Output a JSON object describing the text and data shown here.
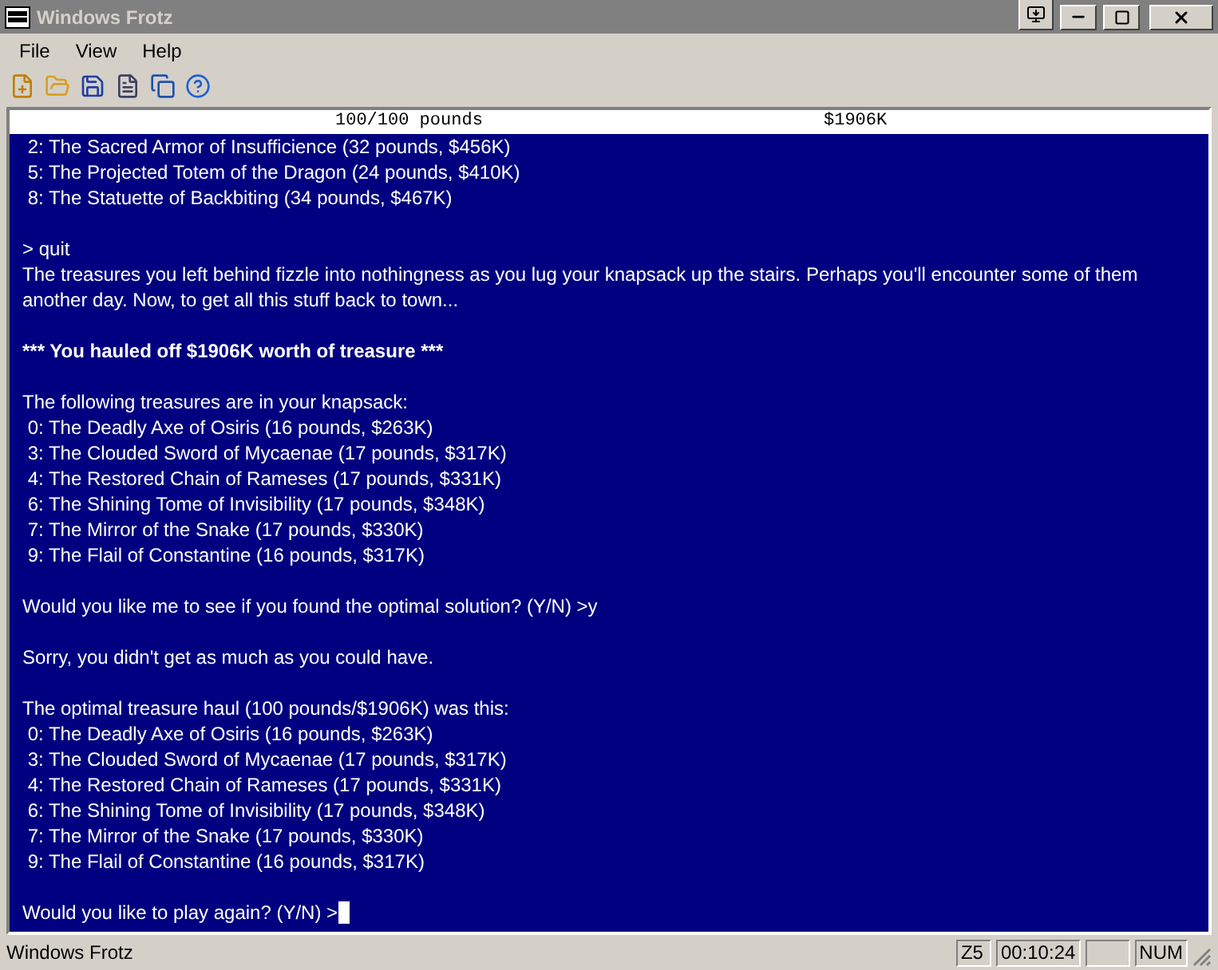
{
  "window": {
    "title": "Windows Frotz"
  },
  "menu": [
    {
      "label": "File"
    },
    {
      "label": "View"
    },
    {
      "label": "Help"
    }
  ],
  "status_line": {
    "left": "100/100 pounds",
    "right": "$1906K"
  },
  "transcript": [
    {
      "kind": "text",
      "text": " 2: The Sacred Armor of Insufficience (32 pounds, $456K)"
    },
    {
      "kind": "text",
      "text": " 5: The Projected Totem of the Dragon (24 pounds, $410K)"
    },
    {
      "kind": "text",
      "text": " 8: The Statuette of Backbiting (34 pounds, $467K)"
    },
    {
      "kind": "gap"
    },
    {
      "kind": "text",
      "text": "> quit"
    },
    {
      "kind": "text",
      "text": "The treasures you left behind fizzle into nothingness as you lug your knapsack up the stairs. Perhaps you'll encounter some of them another day. Now, to get all this stuff back to town..."
    },
    {
      "kind": "gap"
    },
    {
      "kind": "bold",
      "text": "*** You hauled off $1906K worth of treasure ***"
    },
    {
      "kind": "gap"
    },
    {
      "kind": "text",
      "text": "The following treasures are in your knapsack:"
    },
    {
      "kind": "text",
      "text": " 0: The Deadly Axe of Osiris (16 pounds, $263K)"
    },
    {
      "kind": "text",
      "text": " 3: The Clouded Sword of Mycaenae (17 pounds, $317K)"
    },
    {
      "kind": "text",
      "text": " 4: The Restored Chain of Rameses (17 pounds, $331K)"
    },
    {
      "kind": "text",
      "text": " 6: The Shining Tome of Invisibility (17 pounds, $348K)"
    },
    {
      "kind": "text",
      "text": " 7: The Mirror of the Snake (17 pounds, $330K)"
    },
    {
      "kind": "text",
      "text": " 9: The Flail of Constantine (16 pounds, $317K)"
    },
    {
      "kind": "gap"
    },
    {
      "kind": "text",
      "text": "Would you like me to see if you found the optimal solution? (Y/N) >y"
    },
    {
      "kind": "gap"
    },
    {
      "kind": "text",
      "text": "Sorry, you didn't get as much as you could have."
    },
    {
      "kind": "gap"
    },
    {
      "kind": "text",
      "text": "The optimal treasure haul (100 pounds/$1906K) was this:"
    },
    {
      "kind": "text",
      "text": " 0: The Deadly Axe of Osiris (16 pounds, $263K)"
    },
    {
      "kind": "text",
      "text": " 3: The Clouded Sword of Mycaenae (17 pounds, $317K)"
    },
    {
      "kind": "text",
      "text": " 4: The Restored Chain of Rameses (17 pounds, $331K)"
    },
    {
      "kind": "text",
      "text": " 6: The Shining Tome of Invisibility (17 pounds, $348K)"
    },
    {
      "kind": "text",
      "text": " 7: The Mirror of the Snake (17 pounds, $330K)"
    },
    {
      "kind": "text",
      "text": " 9: The Flail of Constantine (16 pounds, $317K)"
    },
    {
      "kind": "gap"
    },
    {
      "kind": "input",
      "text": "Would you like to play again? (Y/N) >"
    }
  ],
  "status_bar": {
    "text": "Windows Frotz",
    "panes": [
      {
        "kind": "text",
        "text": "Z5"
      },
      {
        "kind": "text",
        "text": "00:10:24"
      },
      {
        "kind": "blank"
      },
      {
        "kind": "text",
        "text": "NUM"
      }
    ]
  }
}
